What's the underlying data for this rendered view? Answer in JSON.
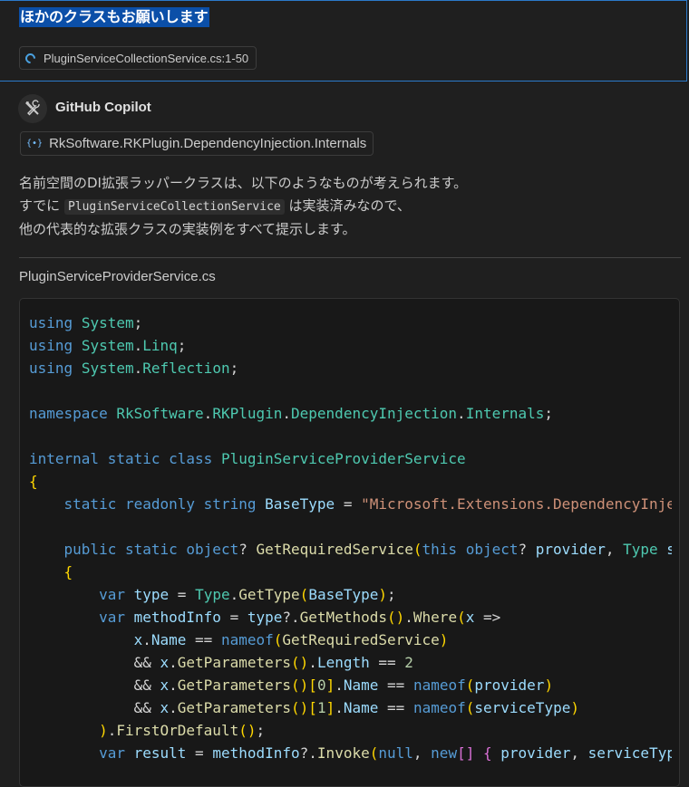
{
  "request": {
    "text": "ほかのクラスもお願いします",
    "reference": {
      "file": "PluginServiceCollectionService.cs",
      "range": ":1-50"
    }
  },
  "assistant": {
    "name": "GitHub Copilot",
    "icon": "copilot-icon",
    "reference": "RkSoftware.RKPlugin.DependencyInjection.Internals",
    "reference_icon": "namespace-icon"
  },
  "message": {
    "line1": "名前空間のDI拡張ラッパークラスは、以下のようなものが考えられます。",
    "line2_prefix": "すでに",
    "line2_code": "PluginServiceCollectionService",
    "line2_suffix": "は実装済みなので、",
    "line3": "他の代表的な拡張クラスの実装例をすべて提示します。"
  },
  "code_block": {
    "filename": "PluginServiceProviderService.cs",
    "language": "csharp",
    "lines": [
      "using System;",
      "using System.Linq;",
      "using System.Reflection;",
      "",
      "namespace RkSoftware.RKPlugin.DependencyInjection.Internals;",
      "",
      "internal static class PluginServiceProviderService",
      "{",
      "    static readonly string BaseType = \"Microsoft.Extensions.DependencyInje",
      "",
      "    public static object? GetRequiredService(this object? provider, Type s",
      "    {",
      "        var type = Type.GetType(BaseType);",
      "        var methodInfo = type?.GetMethods().Where(x =>",
      "            x.Name == nameof(GetRequiredService)",
      "            && x.GetParameters().Length == 2",
      "            && x.GetParameters()[0].Name == nameof(provider)",
      "            && x.GetParameters()[1].Name == nameof(serviceType)",
      "        ).FirstOrDefault();",
      "        var result = methodInfo?.Invoke(null, new[] { provider, serviceTyp"
    ]
  },
  "colors": {
    "accent": "#2b79c9",
    "selection": "#0b4fa8",
    "background": "#1f1f1f",
    "code_background": "#181818"
  }
}
